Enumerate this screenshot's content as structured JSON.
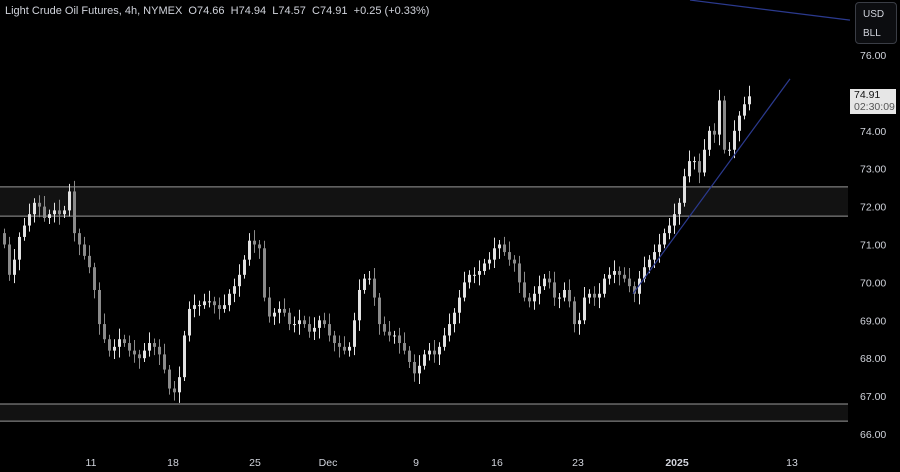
{
  "header": {
    "symbol": "Light Crude Oil Futures, 4h, NYMEX",
    "open": "O74.66",
    "high": "H74.94",
    "low": "L74.57",
    "close": "C74.91",
    "change": "+0.25 (+0.33%)"
  },
  "currency": {
    "unit": "USD",
    "measure": "BLL"
  },
  "last_price": {
    "value": "74.91",
    "countdown": "02:30:09"
  },
  "colors": {
    "background": "#000000",
    "up": "#e2e2e2",
    "down": "#8a8a8a",
    "zone": "#121212",
    "zone_line": "#9a9a9a",
    "trendline": "#2b3a8f",
    "axis_text": "#d1d4dc"
  },
  "chart_data": {
    "type": "candlestick",
    "title": "Light Crude Oil Futures, 4h, NYMEX",
    "ylim": [
      65.9,
      76.5
    ],
    "y_ticks": [
      "66.00",
      "67.00",
      "68.00",
      "69.00",
      "70.00",
      "71.00",
      "72.00",
      "73.00",
      "74.00",
      "75.00",
      "76.00"
    ],
    "x_ticks": [
      {
        "label": "11",
        "index": 17.6
      },
      {
        "label": "18",
        "index": 34
      },
      {
        "label": "25",
        "index": 50.4
      },
      {
        "label": "Dec",
        "index": 65
      },
      {
        "label": "9",
        "index": 82.6
      },
      {
        "label": "16",
        "index": 98.8
      },
      {
        "label": "23",
        "index": 115
      },
      {
        "label": "2025",
        "index": 134.8
      },
      {
        "label": "13",
        "index": 157.8
      }
    ],
    "close": [
      71.0,
      70.2,
      70.6,
      71.2,
      71.5,
      71.8,
      72.1,
      72.0,
      71.7,
      71.8,
      71.9,
      71.8,
      71.9,
      72.4,
      71.3,
      71.0,
      70.7,
      70.4,
      69.8,
      68.9,
      68.5,
      68.2,
      68.3,
      68.5,
      68.4,
      68.2,
      68.1,
      68.0,
      68.2,
      68.4,
      68.3,
      68.1,
      67.7,
      67.2,
      67.1,
      67.5,
      68.6,
      69.3,
      69.4,
      69.4,
      69.5,
      69.5,
      69.4,
      69.3,
      69.4,
      69.7,
      69.9,
      70.2,
      70.6,
      71.1,
      71.0,
      70.9,
      69.6,
      69.1,
      69.2,
      69.3,
      69.2,
      68.9,
      68.9,
      69.0,
      68.9,
      68.7,
      68.8,
      69.0,
      68.9,
      68.6,
      68.4,
      68.3,
      68.2,
      68.3,
      69.0,
      69.8,
      70.1,
      70.1,
      69.6,
      68.9,
      68.7,
      68.6,
      68.6,
      68.4,
      68.2,
      67.9,
      67.6,
      67.8,
      68.1,
      68.2,
      68.1,
      68.3,
      68.6,
      68.9,
      69.2,
      69.6,
      70.0,
      70.2,
      70.2,
      70.3,
      70.5,
      70.6,
      70.9,
      71.0,
      70.8,
      70.6,
      70.5,
      70.0,
      69.6,
      69.5,
      69.7,
      69.9,
      70.1,
      70.0,
      69.6,
      69.6,
      69.8,
      69.5,
      68.9,
      69.0,
      69.6,
      69.7,
      69.6,
      69.7,
      70.1,
      70.2,
      70.3,
      70.2,
      70.1,
      69.9,
      69.7,
      70.1,
      70.4,
      70.6,
      70.8,
      71.0,
      71.3,
      71.5,
      71.8,
      72.1,
      72.8,
      73.2,
      73.2,
      72.9,
      73.5,
      74.0,
      73.9,
      74.8,
      73.5,
      73.5,
      74.0,
      74.4,
      74.7,
      74.91
    ],
    "zones": [
      {
        "top": 72.52,
        "bottom": 71.75
      },
      {
        "top": 66.79,
        "bottom": 66.34
      }
    ],
    "lines": [
      {
        "name": "uptrend",
        "from": [
          126,
          69.7
        ],
        "to": [
          157.4,
          75.37
        ]
      },
      {
        "name": "upper-line",
        "from": [
          137.4,
          77.45
        ],
        "to": [
          169.4,
          76.92
        ]
      }
    ]
  }
}
